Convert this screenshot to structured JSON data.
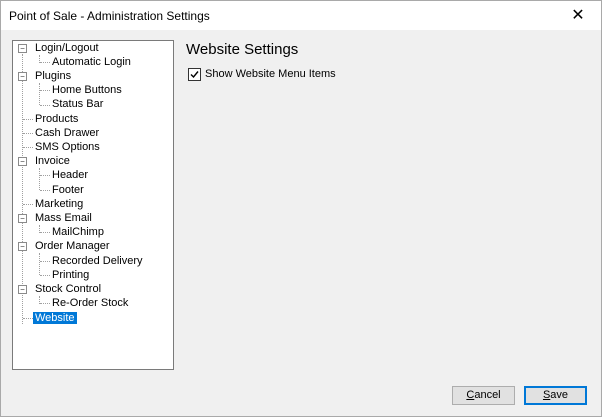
{
  "window": {
    "title": "Point of Sale - Administration Settings",
    "close_glyph": "✕"
  },
  "tree": {
    "items": [
      {
        "label": "Login/Logout"
      },
      {
        "label": "Automatic Login"
      },
      {
        "label": "Plugins"
      },
      {
        "label": "Home Buttons"
      },
      {
        "label": "Status Bar"
      },
      {
        "label": "Products"
      },
      {
        "label": "Cash Drawer"
      },
      {
        "label": "SMS Options"
      },
      {
        "label": "Invoice"
      },
      {
        "label": "Header"
      },
      {
        "label": "Footer"
      },
      {
        "label": "Marketing"
      },
      {
        "label": "Mass Email"
      },
      {
        "label": "MailChimp"
      },
      {
        "label": "Order Manager"
      },
      {
        "label": "Recorded Delivery"
      },
      {
        "label": "Printing"
      },
      {
        "label": "Stock Control"
      },
      {
        "label": "Re-Order Stock"
      },
      {
        "label": "Website"
      }
    ],
    "selected": "Website",
    "expanded_glyph": "−"
  },
  "content": {
    "title": "Website Settings",
    "checkbox_label": "Show Website Menu Items",
    "checkbox_checked": true
  },
  "buttons": {
    "cancel": {
      "first": "C",
      "rest": "ancel"
    },
    "save": {
      "first": "S",
      "rest": "ave"
    }
  },
  "colors": {
    "selection": "#0078d7",
    "default_button_border": "#0078d7"
  }
}
